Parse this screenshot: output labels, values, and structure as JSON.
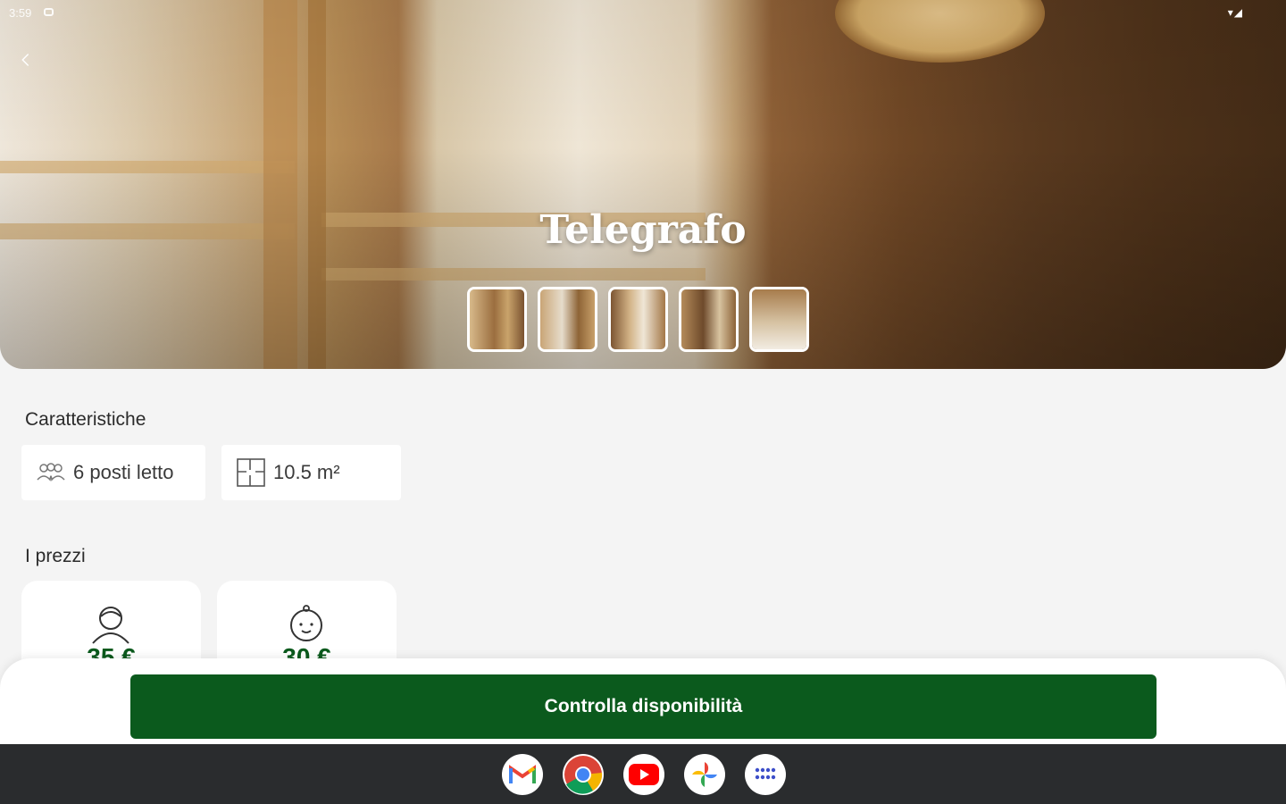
{
  "status_bar": {
    "time": "3:59"
  },
  "room": {
    "name": "Telegrafo"
  },
  "features": {
    "heading": "Caratteristiche",
    "beds": "6 posti letto",
    "area": "10.5 m²"
  },
  "prices": {
    "heading": "I prezzi",
    "adult_price": "35 €",
    "child_price": "30 €"
  },
  "cta": {
    "label": "Controlla disponibilità"
  },
  "dock_apps": [
    "gmail-icon",
    "chrome-icon",
    "youtube-icon",
    "photos-icon",
    "app-drawer-icon"
  ],
  "colors": {
    "accent_green": "#0b5a1d",
    "background": "#f4f4f4"
  }
}
